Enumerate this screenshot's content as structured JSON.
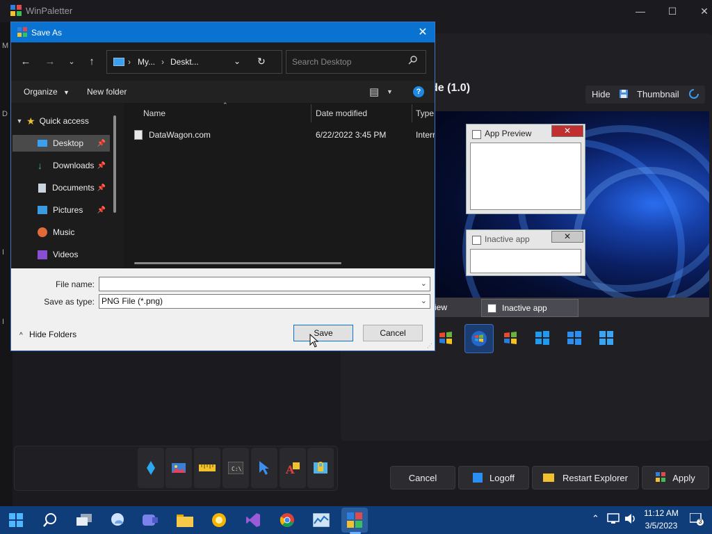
{
  "app": {
    "title": "WinPaletter",
    "mode_title": "de (1.0)",
    "strip_letters": [
      "M",
      "D",
      "I",
      "I"
    ],
    "hide_label": "Hide",
    "thumbnail_label": "Thumbnail",
    "preview": {
      "active_window_title": "App Preview",
      "inactive_window_title": "Inactive app",
      "tab_preview": "iew",
      "tab_inactive": "Inactive app"
    },
    "buttons": {
      "cancel": "Cancel",
      "logoff": "Logoff",
      "restart_explorer": "Restart Explorer",
      "apply": "Apply"
    }
  },
  "dialog": {
    "title": "Save As",
    "address": {
      "seg1": "My...",
      "seg2": "Deskt..."
    },
    "search_placeholder": "Search Desktop",
    "toolbar": {
      "organize": "Organize",
      "new_folder": "New folder"
    },
    "sidebar": [
      {
        "label": "Quick access"
      },
      {
        "label": "Desktop"
      },
      {
        "label": "Downloads"
      },
      {
        "label": "Documents"
      },
      {
        "label": "Pictures"
      },
      {
        "label": "Music"
      },
      {
        "label": "Videos"
      }
    ],
    "columns": {
      "name": "Name",
      "date": "Date modified",
      "type": "Type"
    },
    "files": [
      {
        "name": "DataWagon.com",
        "date": "6/22/2022 3:45 PM",
        "type": "Interr"
      }
    ],
    "file_name_label": "File name:",
    "file_name_value": "",
    "save_type_label": "Save as type:",
    "save_type_value": "PNG File (*.png)",
    "hide_folders": "Hide Folders",
    "save_button": "Save",
    "cancel_button": "Cancel"
  },
  "taskbar": {
    "time": "11:12 AM",
    "date": "3/5/2023",
    "notification_count": "3"
  },
  "colors": {
    "accent": "#0a73d1",
    "taskbar": "#0f3d7a"
  }
}
